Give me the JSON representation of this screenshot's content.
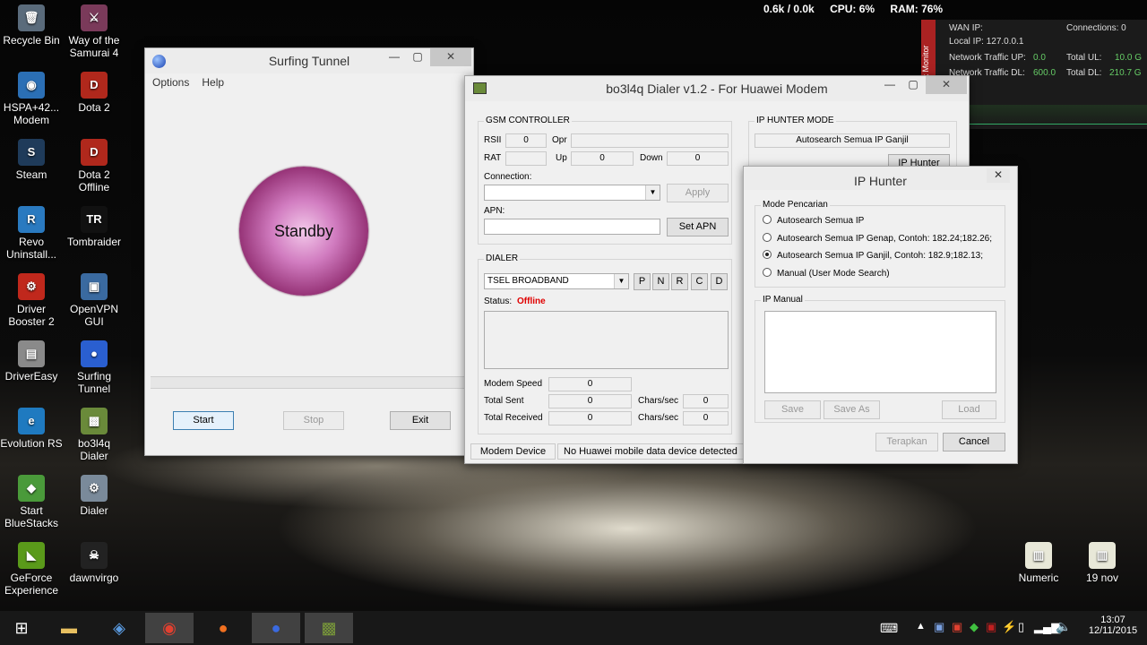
{
  "stats": {
    "net": "0.6k / 0.0k",
    "cpu": "CPU: 6%",
    "ram": "RAM: 76%"
  },
  "netmon": {
    "side_label": "Network Monitor",
    "wan_ip": "WAN IP:",
    "connections": "Connections: 0",
    "local_ip": "Local IP: 127.0.0.1",
    "up_label": "Network Traffic UP:",
    "up_value": "0.0",
    "total_ul_label": "Total UL:",
    "total_ul_value": "10.0 G",
    "dl_label": "Network Traffic DL:",
    "dl_value": "600.0",
    "total_dl_label": "Total DL:",
    "total_dl_value": "210.7 G"
  },
  "desktop_icons": [
    {
      "label": "Recycle Bin",
      "glyph": "🗑",
      "color": "#5a6b7b"
    },
    {
      "label": "Way of the Samurai 4",
      "glyph": "⚔",
      "color": "#7a3a5a"
    },
    {
      "label": "HSPA+42... Modem",
      "glyph": "◉",
      "color": "#2b6fb5"
    },
    {
      "label": "Dota 2",
      "glyph": "D",
      "color": "#b0281c"
    },
    {
      "label": "Steam",
      "glyph": "S",
      "color": "#1f3b5a"
    },
    {
      "label": "Dota 2 Offline",
      "glyph": "D",
      "color": "#b0281c"
    },
    {
      "label": "Revo Uninstall...",
      "glyph": "R",
      "color": "#2a7ac0"
    },
    {
      "label": "Tombraider",
      "glyph": "TR",
      "color": "#111111"
    },
    {
      "label": "Driver Booster 2",
      "glyph": "⚙",
      "color": "#c0281c"
    },
    {
      "label": "OpenVPN GUI",
      "glyph": "▣",
      "color": "#3a6aa0"
    },
    {
      "label": "DriverEasy",
      "glyph": "▤",
      "color": "#8a8a8a"
    },
    {
      "label": "Surfing Tunnel",
      "glyph": "●",
      "color": "#2a5fd0"
    },
    {
      "label": "Evolution RS",
      "glyph": "e",
      "color": "#1f7ac0"
    },
    {
      "label": "bo3l4q Dialer",
      "glyph": "▩",
      "color": "#6a8a3a"
    },
    {
      "label": "Start BlueStacks",
      "glyph": "◆",
      "color": "#4a9a3a"
    },
    {
      "label": "Dialer",
      "glyph": "⚙",
      "color": "#7a8a9a"
    },
    {
      "label": "GeForce Experience",
      "glyph": "◣",
      "color": "#5a9a1a"
    },
    {
      "label": "dawnvirgo",
      "glyph": "☠",
      "color": "#222222"
    },
    {
      "label": "Numeric",
      "glyph": "▥",
      "color": "#e8e8d8"
    },
    {
      "label": "19 nov",
      "glyph": "▥",
      "color": "#e8e8d8"
    }
  ],
  "surfing": {
    "title": "Surfing Tunnel",
    "menu": [
      "Options",
      "Help"
    ],
    "status": "Standby",
    "start": "Start",
    "stop": "Stop",
    "exit": "Exit"
  },
  "dialer": {
    "title": "bo3l4q Dialer v1.2 - For Huawei Modem",
    "gsm_title": "GSM CONTROLLER",
    "rsii_label": "RSII",
    "rsii_value": "0",
    "opr_label": "Opr",
    "opr_value": "",
    "rat_label": "RAT",
    "rat_value": "",
    "up_label": "Up",
    "up_value": "0",
    "down_label": "Down",
    "down_value": "0",
    "connection_label": "Connection:",
    "connection_value": "",
    "apply": "Apply",
    "apn_label": "APN:",
    "apn_value": "",
    "set_apn": "Set APN",
    "dialer_title": "DIALER",
    "profile": "TSEL BROADBAND",
    "letters": [
      "P",
      "N",
      "R",
      "C",
      "D"
    ],
    "status_label": "Status:",
    "status_value": "Offline",
    "modem_speed_label": "Modem Speed",
    "modem_speed_value": "0",
    "total_sent_label": "Total Sent",
    "total_sent_value": "0",
    "chars_label": "Chars/sec",
    "chars_sent_value": "0",
    "total_received_label": "Total Received",
    "total_received_value": "0",
    "chars_recv_value": "0",
    "iphunter_mode_title": "IP HUNTER MODE",
    "iphunter_mode_value": "Autosearch Semua IP Ganjil",
    "ip_hunter_button": "IP Hunter",
    "statusbar_device": "Modem Device",
    "statusbar_msg": "No Huawei mobile data device detected"
  },
  "iphunter": {
    "title": "IP Hunter",
    "mode_title": "Mode Pencarian",
    "options": [
      "Autosearch Semua IP",
      "Autosearch Semua IP Genap, Contoh: 182.24;182.26;",
      "Autosearch Semua IP Ganjil, Contoh: 182.9;182.13;",
      "Manual (User Mode Search)"
    ],
    "selected_index": 2,
    "manual_title": "IP Manual",
    "save": "Save",
    "save_as": "Save As",
    "load": "Load",
    "terapkan": "Terapkan",
    "cancel": "Cancel"
  },
  "taskbar": {
    "time": "13:07",
    "date": "12/11/2015"
  }
}
